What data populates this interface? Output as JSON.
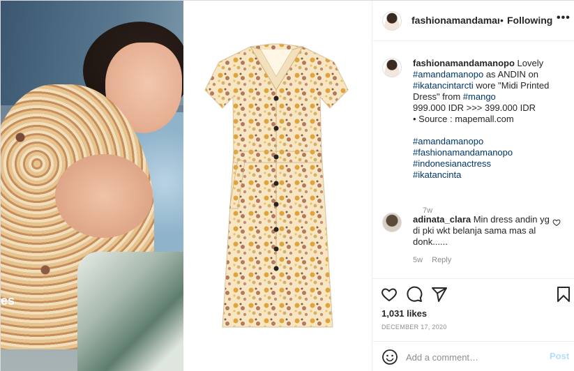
{
  "colors": {
    "link": "#00376b",
    "muted": "#8e8e8e",
    "post_button": "#b2dffc",
    "text": "#262626"
  },
  "media": {
    "left_photo_text": "es"
  },
  "header": {
    "username": "fashionamandamanopo",
    "separator": "•",
    "follow_status": "Following",
    "more_label": "•••"
  },
  "caption": {
    "username": "fashionamandamanopo",
    "p1": " Lovely ",
    "tag1": "#amandamanopo",
    "p2": " as ANDIN on ",
    "tag2": "#ikatancintarcti",
    "p3": " wore \"Midi Printed Dress\" from ",
    "tag3": "#mango",
    "price_line": "999.000 IDR >>> 399.000 IDR",
    "source_line": "• Source : mapemall.com",
    "hashtags": [
      "#amandamanopo",
      "#fashionamandamanopo",
      "#indonesianactress",
      "#ikatancinta"
    ],
    "time": "7w"
  },
  "comment": {
    "username": "adinata_clara",
    "text": " Min dress andin yg di pki wkt belanja sama mas al donk......",
    "time": "5w",
    "reply_label": "Reply"
  },
  "actions": {
    "likes": "1,031 likes",
    "date": "DECEMBER 17, 2020"
  },
  "add_comment": {
    "placeholder": "Add a comment…",
    "post_label": "Post"
  }
}
